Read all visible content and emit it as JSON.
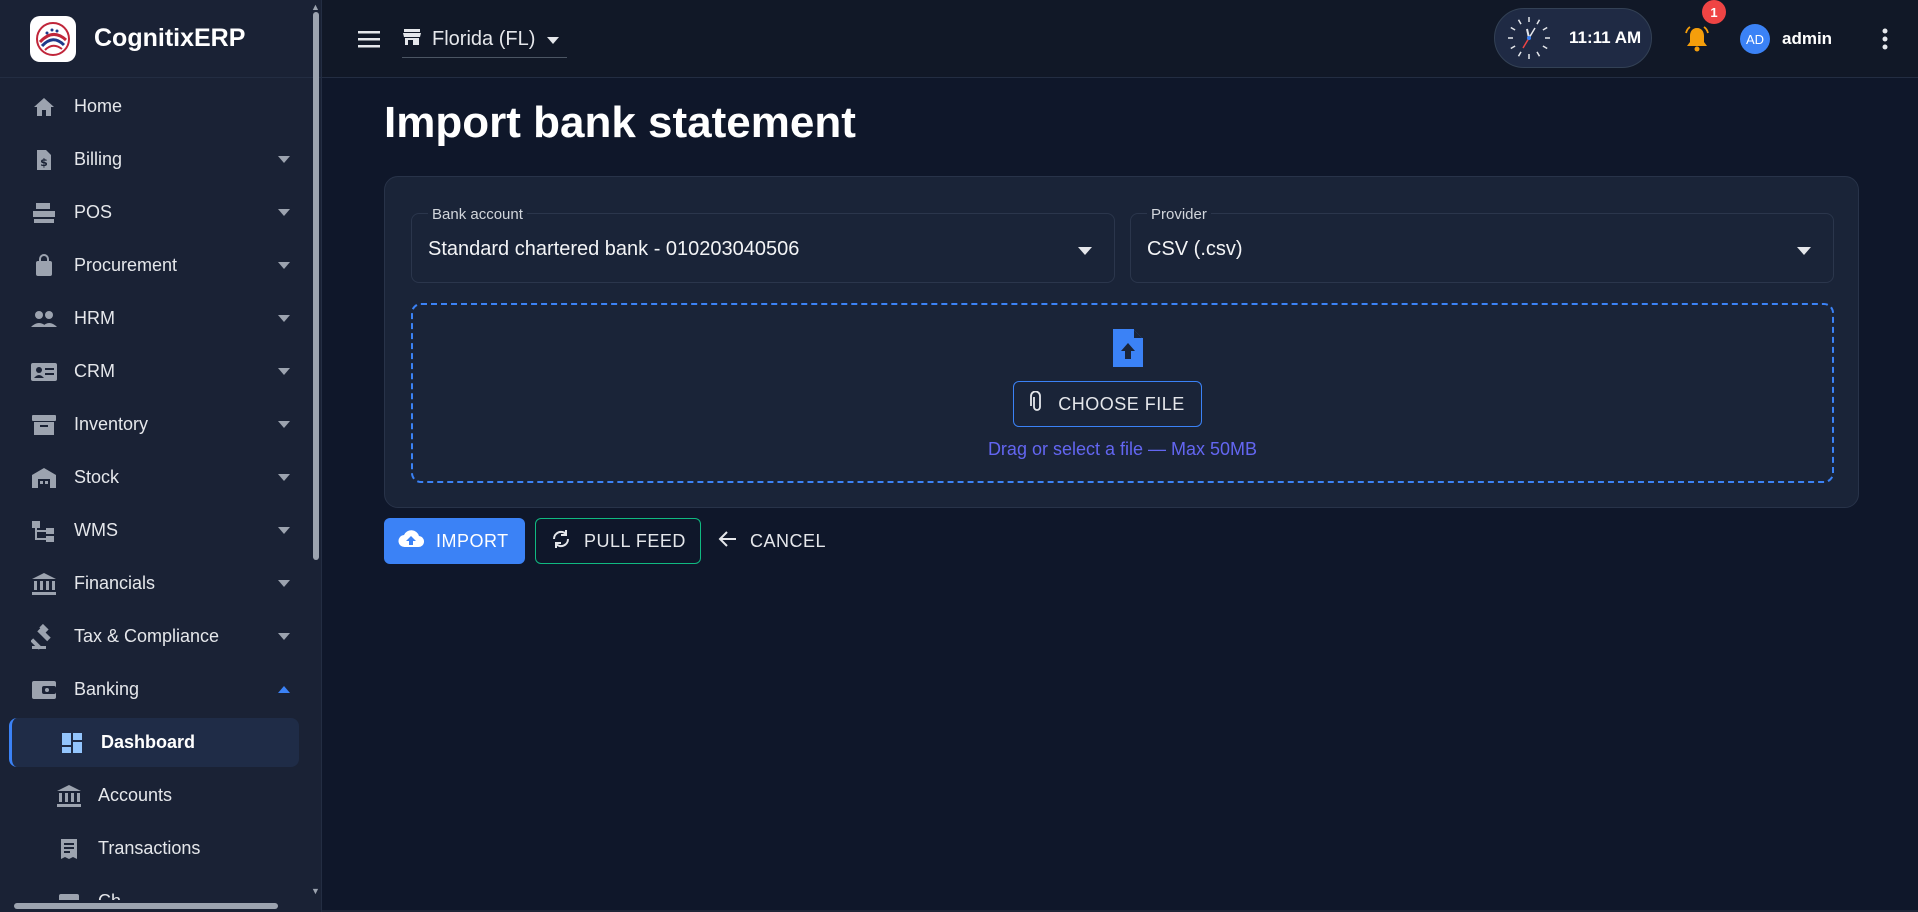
{
  "brand": {
    "name": "CognitixERP"
  },
  "sidebar": {
    "items": [
      {
        "label": "Home",
        "icon": "home-icon"
      },
      {
        "label": "Billing",
        "icon": "billing-icon"
      },
      {
        "label": "POS",
        "icon": "pos-icon"
      },
      {
        "label": "Procurement",
        "icon": "shopping-bag-icon"
      },
      {
        "label": "HRM",
        "icon": "people-icon"
      },
      {
        "label": "CRM",
        "icon": "contact-card-icon"
      },
      {
        "label": "Inventory",
        "icon": "archive-icon"
      },
      {
        "label": "Stock",
        "icon": "warehouse-icon"
      },
      {
        "label": "WMS",
        "icon": "hierarchy-icon"
      },
      {
        "label": "Financials",
        "icon": "bank-icon"
      },
      {
        "label": "Tax & Compliance",
        "icon": "gavel-icon"
      },
      {
        "label": "Banking",
        "icon": "wallet-icon"
      }
    ],
    "banking_sub": [
      {
        "label": "Dashboard",
        "icon": "dashboard-icon"
      },
      {
        "label": "Accounts",
        "icon": "bank-icon"
      },
      {
        "label": "Transactions",
        "icon": "receipt-icon"
      },
      {
        "label": "Ch..."
      }
    ]
  },
  "topbar": {
    "store": "Florida (FL)",
    "time": "11:11 AM",
    "notifications_count": "1",
    "avatar_initials": "AD",
    "user": "admin"
  },
  "page": {
    "title": "Import bank statement",
    "bank_account_label": "Bank account",
    "bank_account_value": "Standard chartered bank - 010203040506",
    "provider_label": "Provider",
    "provider_value": "CSV (.csv)",
    "choose_file": "CHOOSE FILE",
    "hint": "Drag or select a file — Max 50MB",
    "import": "IMPORT",
    "pull_feed": "PULL FEED",
    "cancel": "CANCEL"
  },
  "colors": {
    "accent": "#3b82f6",
    "feed_border": "#10b981",
    "hint": "#6366f1",
    "badge": "#ef4444",
    "bell": "#f59e0b"
  }
}
